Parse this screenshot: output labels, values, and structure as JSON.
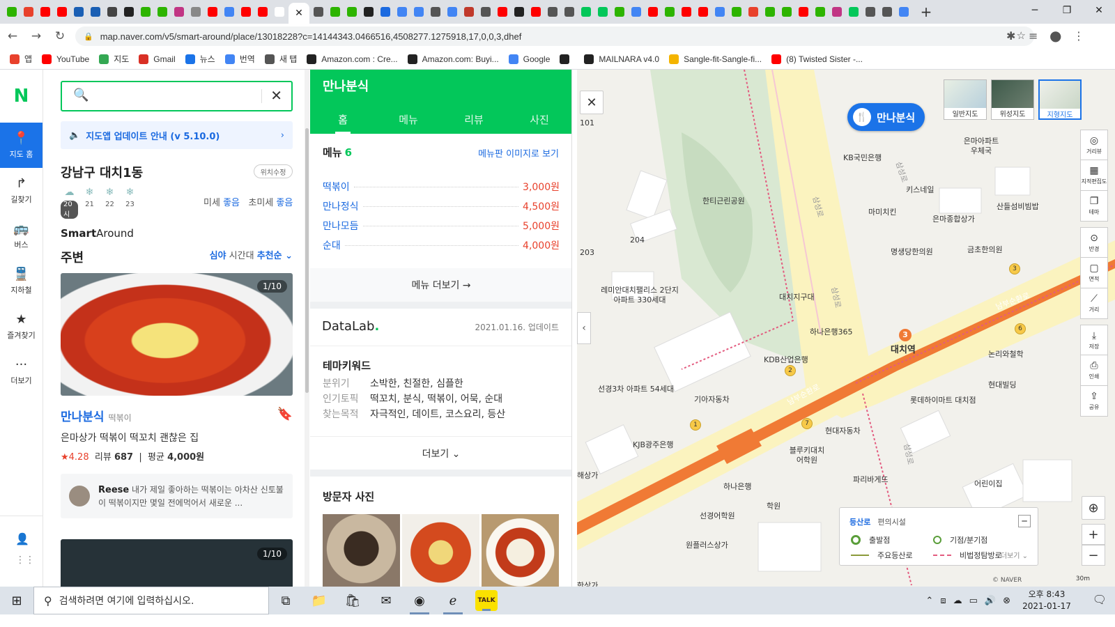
{
  "browser": {
    "url": "map.naver.com/v5/smart-around/place/13018228?c=14144343.0466516,4508277.1275918,17,0,0,3,dhef",
    "tab_colors": [
      "#2db400",
      "#e8412c",
      "#ff0000",
      "#ff0000",
      "#1a5fb4",
      "#1a5fb4",
      "#444",
      "#222",
      "#2db400",
      "#2db400",
      "#c13584",
      "#888",
      "#ff0000",
      "#4285f4",
      "#ff0000",
      "#ff0000",
      "#ffffff",
      "#4285f4",
      "#555",
      "#2db400",
      "#2db400",
      "#222",
      "#1b6ae0",
      "#4285f4",
      "#4285f4",
      "#555",
      "#4285f4",
      "#c0392b",
      "#555",
      "#ff0000",
      "#222",
      "#ff0000",
      "#555",
      "#555",
      "#03c75a",
      "#03c75a",
      "#2db400",
      "#4285f4",
      "#ff0000",
      "#2db400",
      "#ff0000",
      "#ff0000",
      "#4285f4",
      "#2db400",
      "#e8412c",
      "#2db400",
      "#2db400",
      "#ff0000",
      "#2db400",
      "#c13584",
      "#03c75a",
      "#555",
      "#555",
      "#4285f4"
    ],
    "new_tab_label": "+",
    "win_minimize": "─",
    "win_maximize": "❐",
    "win_close": "✕",
    "back": "←",
    "forward": "→",
    "reload": "↻",
    "lock": "🔒",
    "star": "☆",
    "ext": "✱",
    "menu_icon": "≡",
    "profile": "●",
    "kebab": "⋮"
  },
  "bookmarks": [
    {
      "label": "앱",
      "color": "#e8412c"
    },
    {
      "label": "YouTube",
      "color": "#ff0000"
    },
    {
      "label": "지도",
      "color": "#34a853"
    },
    {
      "label": "Gmail",
      "color": "#d93025"
    },
    {
      "label": "뉴스",
      "color": "#1a73e8"
    },
    {
      "label": "번역",
      "color": "#4285f4"
    },
    {
      "label": "새 탭",
      "color": "#555555"
    },
    {
      "label": "Amazon.com : Cre...",
      "color": "#222222"
    },
    {
      "label": "Amazon.com: Buyi...",
      "color": "#222222"
    },
    {
      "label": "Google",
      "color": "#4285f4"
    },
    {
      "label": "",
      "color": "#222222"
    },
    {
      "label": "MAILNARA v4.0",
      "color": "#222222"
    },
    {
      "label": "Sangle-fit-Sangle-fi...",
      "color": "#f4b400"
    },
    {
      "label": "(8) Twisted Sister -...",
      "color": "#ff0000"
    }
  ],
  "nav": {
    "logo": "N",
    "items": [
      {
        "label": "지도 홈",
        "icon": "📍"
      },
      {
        "label": "길찾기",
        "icon": "↱"
      },
      {
        "label": "버스",
        "icon": "🚌"
      },
      {
        "label": "지하철",
        "icon": "🚆"
      },
      {
        "label": "즐겨찾기",
        "icon": "★"
      },
      {
        "label": "더보기",
        "icon": "···"
      }
    ],
    "bottom_icons": [
      "👤",
      "⋮⋮"
    ]
  },
  "panel": {
    "search_value": "",
    "notice": "지도앱 업데이트 안내 (v 5.10.0)",
    "notice_arrow": "›",
    "region": "강남구 대치1동",
    "loc_edit": "위치수정",
    "weather": [
      {
        "day": "20시",
        "icon": "☁"
      },
      {
        "day": "21",
        "icon": "❄"
      },
      {
        "day": "22",
        "icon": "❄"
      },
      {
        "day": "23",
        "icon": "❄"
      }
    ],
    "dust_label": "미세",
    "dust_value": "좋음",
    "ufdust_label": "초미세",
    "ufdust_value": "좋음",
    "smart_a": "Smart",
    "smart_b": "Around",
    "nearby": "주변",
    "time_a": "심야",
    "time_b": "시간대",
    "time_c": "추천순 ⌄",
    "photo_badge": "1/10",
    "place_name": "만나분식",
    "place_cat": "떡볶이",
    "place_desc": "은마상가 떡볶이 떡꼬치 괜찮은 집",
    "rating": "★4.28",
    "review_label": "리뷰",
    "review_count": "687",
    "avg_label": "평균",
    "avg_price": "4,000원",
    "review_user": "Reese",
    "review_text": "내가 제일 좋아하는 떡볶이는 아차산 신토불이 떡볶이지만 몇일 전에먹어서 새로운 ...",
    "photo2_badge": "1/10"
  },
  "detail": {
    "title": "만나분식",
    "tabs": [
      "홈",
      "메뉴",
      "리뷰",
      "사진"
    ],
    "menu_title": "메뉴",
    "menu_count": "6",
    "menu_img_link": "메뉴판 이미지로 보기",
    "menu": [
      {
        "name": "떡볶이",
        "price": "3,000원"
      },
      {
        "name": "만나정식",
        "price": "4,500원"
      },
      {
        "name": "만나모듬",
        "price": "5,000원"
      },
      {
        "name": "순대",
        "price": "4,000원"
      }
    ],
    "menu_more": "메뉴 더보기 →",
    "datalab_a": "DataLab",
    "datalab_b": ".",
    "datalab_date": "2021.01.16. 업데이트",
    "theme_title": "테마키워드",
    "themes": [
      {
        "key": "분위기",
        "val": "소박한, 친절한, 심플한"
      },
      {
        "key": "인기토픽",
        "val": "떡꼬치, 분식, 떡볶이, 어묵, 순대"
      },
      {
        "key": "찾는목적",
        "val": "자극적인, 데이트, 코스요리, 등산"
      }
    ],
    "theme_more": "더보기 ⌄",
    "visit_title": "방문자 사진"
  },
  "map": {
    "close": "✕",
    "collapse": "‹",
    "pin_label": "만나분식",
    "pin_icon": "🍴",
    "types": [
      "일반지도",
      "위성지도",
      "지형지도"
    ],
    "tools": [
      {
        "label": "거리뷰",
        "icon": "◎"
      },
      {
        "label": "지적편집도",
        "icon": "▦"
      },
      {
        "label": "테마",
        "icon": "❐"
      },
      {
        "label": "반경",
        "icon": "⊙"
      },
      {
        "label": "면적",
        "icon": "▢"
      },
      {
        "label": "거리",
        "icon": "⟋"
      },
      {
        "label": "저장",
        "icon": "⤓"
      },
      {
        "label": "인쇄",
        "icon": "⎙"
      },
      {
        "label": "공유",
        "icon": "⇪"
      }
    ],
    "labels": [
      "KB국민은행",
      "은마아파트 우체국",
      "키스네일",
      "마미치킨",
      "은마종합상가",
      "산들섬비빔밥",
      "명생당한의원",
      "금초한의원",
      "한티근린공원",
      "대치지구대",
      "하나은행365",
      "대치역",
      "KDB산업은행",
      "논리와철학",
      "현대빌딩",
      "레미안대치팰리스 2단지아파트 330세대",
      "선경3차 아파트 54세대",
      "기아자동차",
      "롯데하이마트 대치점",
      "현대자동차",
      "KJB광주은행",
      "블루키대치 어학원",
      "하나은행",
      "파리바게뜨",
      "어린이집",
      "선경어학원",
      "원플러스상가",
      "101",
      "203",
      "204",
      "해상가",
      "학원",
      "한상가"
    ],
    "road_labels": [
      "남부순환로",
      "삼성로",
      "남부순환로",
      "삼성로",
      "삼성로",
      "삼성로"
    ],
    "station_num": "3",
    "legend_tab_a": "등산로",
    "legend_tab_b": "편의시설",
    "legend_min": "─",
    "legend_items": [
      "출발점",
      "기점/분기점",
      "주요등산로",
      "비법정탐방로"
    ],
    "legend_more": "더보기 ⌄",
    "zoom_in": "+",
    "zoom_out": "−",
    "locate": "⊕",
    "scale": "30m",
    "copyright": "© NAVER",
    "circle_nums": [
      "3",
      "6",
      "2",
      "1",
      "7"
    ]
  },
  "taskbar": {
    "start": "⊞",
    "search_icon": "⚲",
    "search_placeholder": "검색하려면 여기에 입력하십시오.",
    "apps": [
      "⧉",
      "📁",
      "🛍",
      "✉",
      "◉",
      "ℯ",
      "TALK"
    ],
    "tray": [
      "⌃",
      "⧈",
      "☁",
      "▭",
      "🔊",
      "⊗"
    ],
    "time": "오후 8:43",
    "date": "2021-01-17",
    "notif": "🗨"
  }
}
